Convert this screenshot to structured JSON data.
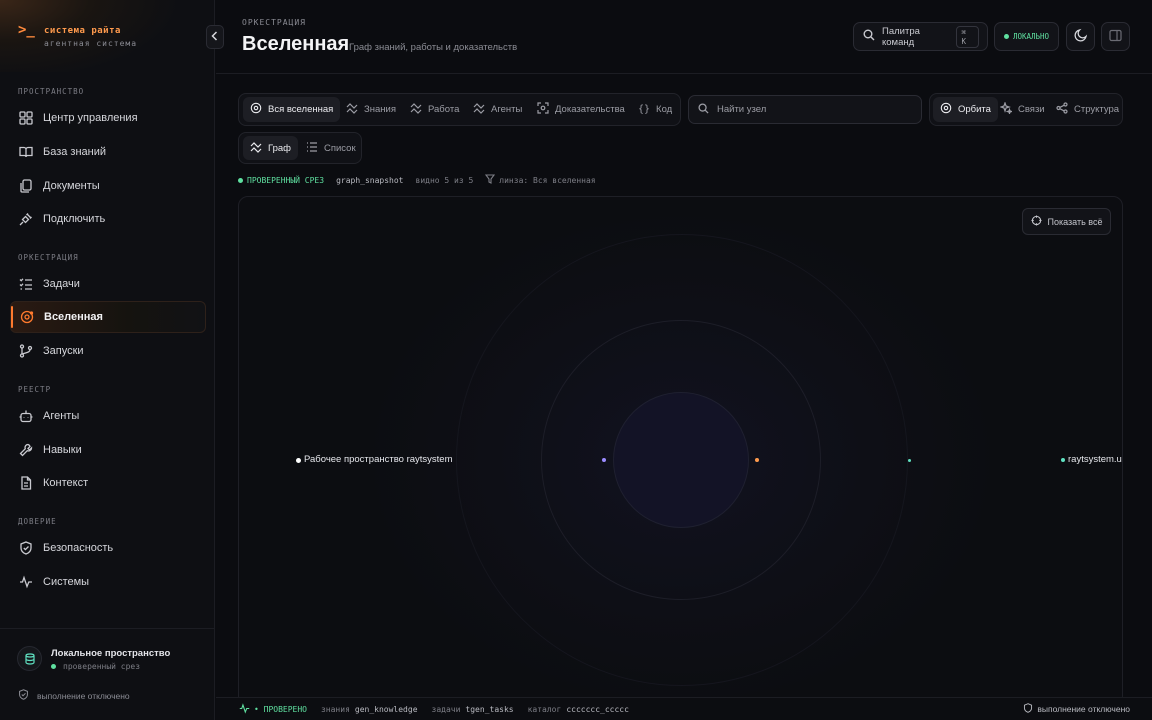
{
  "brand": {
    "prompt": ">_",
    "title": "система райта",
    "subtitle": "агентная система"
  },
  "sidebar": {
    "sections": [
      {
        "title": "ПРОСТРАНСТВО",
        "items": [
          {
            "label": "Центр управления",
            "icon": "dashboard-grid-icon"
          },
          {
            "label": "База знаний",
            "icon": "book-icon"
          },
          {
            "label": "Документы",
            "icon": "documents-icon"
          },
          {
            "label": "Подключить",
            "icon": "plug-icon"
          }
        ]
      },
      {
        "title": "ОРКЕСТРАЦИЯ",
        "items": [
          {
            "label": "Задачи",
            "icon": "tasks-list-icon"
          },
          {
            "label": "Вселенная",
            "icon": "orbit-icon",
            "active": true
          },
          {
            "label": "Запуски",
            "icon": "branch-icon"
          }
        ]
      },
      {
        "title": "РЕЕСТР",
        "items": [
          {
            "label": "Агенты",
            "icon": "robot-icon"
          },
          {
            "label": "Навыки",
            "icon": "wrench-icon"
          },
          {
            "label": "Контекст",
            "icon": "file-context-icon"
          }
        ]
      },
      {
        "title": "ДОВЕРИЕ",
        "items": [
          {
            "label": "Безопасность",
            "icon": "shield-icon"
          },
          {
            "label": "Системы",
            "icon": "activity-icon"
          }
        ]
      }
    ],
    "footer": {
      "workspace_name": "Локальное пространство",
      "workspace_status": "проверенный срез",
      "execution": "выполнение отключено"
    }
  },
  "header": {
    "breadcrumb": "ОРКЕСТРАЦИЯ",
    "title": "Вселенная",
    "subtitle": "Граф знаний, работы и доказательств",
    "command_palette": "Палитра команд",
    "shortcut": "⌘ K",
    "mode_badge": "ЛОКАЛЬНО"
  },
  "filters": {
    "lenses": [
      "Вся вселенная",
      "Знания",
      "Работа",
      "Агенты",
      "Доказательства",
      "Код"
    ],
    "active_lens": "Вся вселенная",
    "search_placeholder": "Найти узел",
    "layouts": [
      "Орбита",
      "Связи",
      "Структура"
    ],
    "active_layout": "Орбита",
    "views": [
      "Граф",
      "Список"
    ],
    "active_view": "Граф"
  },
  "status": {
    "verified": "ПРОВЕРЕННЫЙ СРЕЗ",
    "snapshot": "graph_snapshot",
    "visible": "видно 5 из 5",
    "lens": "линза: Вся вселенная"
  },
  "graph": {
    "fit_button": "Показать всё",
    "nodes": [
      {
        "label": "Рабочее пространство raytsystem",
        "color": "#ffffff"
      },
      {
        "label": "",
        "color": "#9b8cff"
      },
      {
        "label": "",
        "color": "#ff9a4d"
      },
      {
        "label": "",
        "color": "#5fe0c0"
      },
      {
        "label": "raytsystem.ui",
        "color": "#5fe0c0"
      }
    ]
  },
  "footer_bar": {
    "verified": "• ПРОВЕРЕНО",
    "knowledge_label": "знания",
    "knowledge_value": "gen_knowledge",
    "tasks_label": "задачи",
    "tasks_value": "tgen_tasks",
    "catalog_label": "каталог",
    "catalog_value": "ccccccc_ccccc",
    "execution": "выполнение отключено"
  },
  "colors": {
    "accent": "#ff7a2e",
    "success": "#5fe0a0",
    "background": "#0b0c10"
  }
}
